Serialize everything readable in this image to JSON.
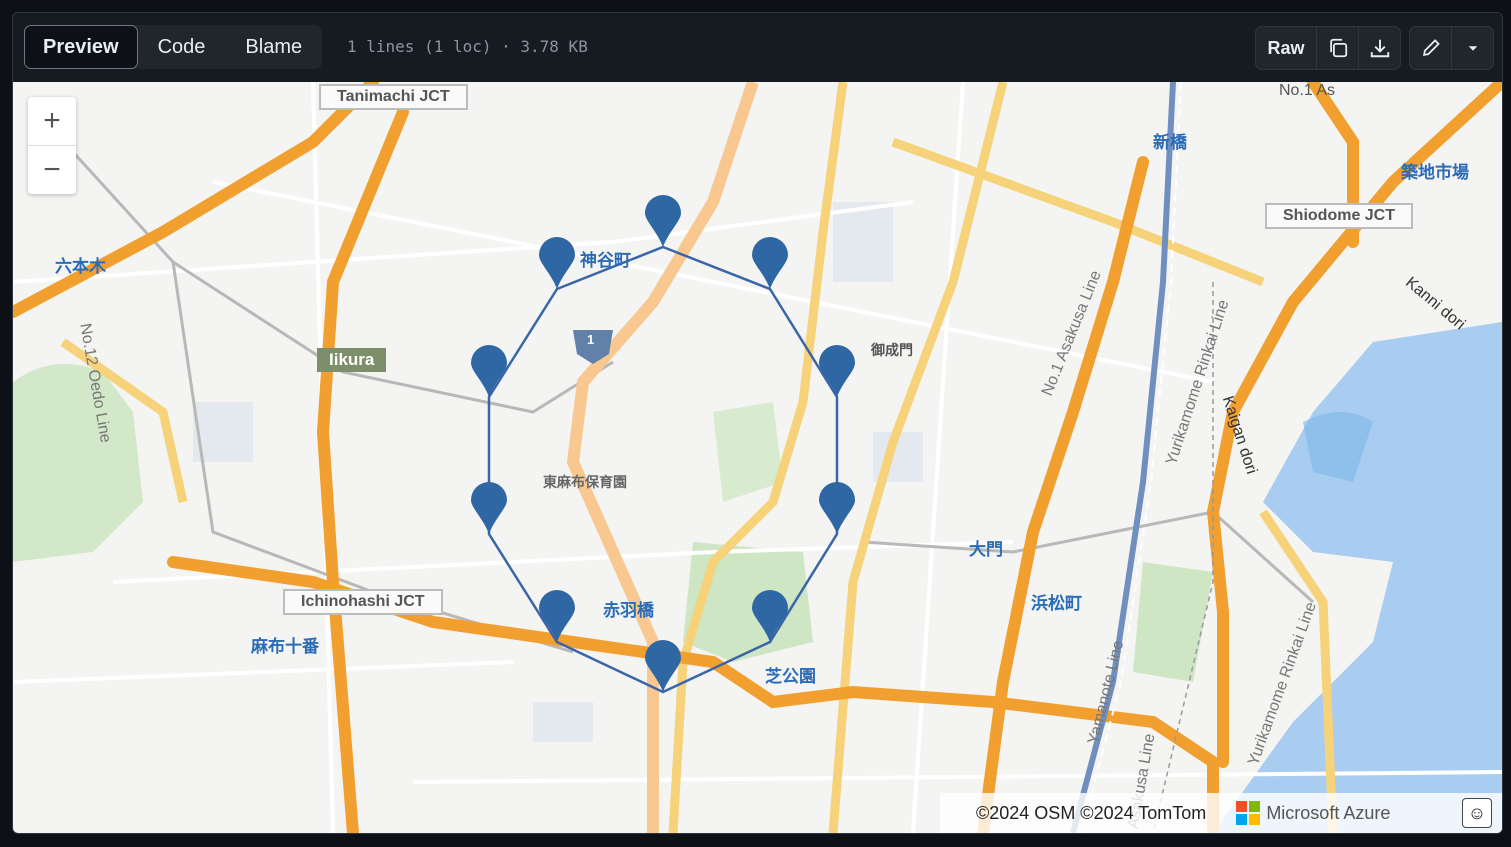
{
  "toolbar": {
    "tabs": [
      "Preview",
      "Code",
      "Blame"
    ],
    "meta": "1 lines (1 loc) · 3.78 KB",
    "raw_label": "Raw",
    "icons": [
      "copy-icon",
      "download-icon",
      "pencil-icon",
      "chevron-down-icon"
    ]
  },
  "map": {
    "zoom_in": "+",
    "zoom_out": "−",
    "labels": {
      "tanimachi": "Tanimachi JCT",
      "roppongi": "六本木",
      "oedo": "No.12 Oedo Line",
      "iikura": "Iikura",
      "kamiyacho": "神谷町",
      "onarimon": "御成門",
      "higashiazabu": "東麻布保育園",
      "ichinohashi": "Ichinohashi JCT",
      "azabujuban": "麻布十番",
      "akabanebashi": "赤羽橋",
      "shibakoen": "芝公園",
      "daimon": "大門",
      "hamamatsucho": "浜松町",
      "shimbashi": "新橋",
      "tsukiji": "築地市場",
      "shiodome": "Shiodome JCT",
      "kanni": "Kanni dori",
      "kaigan": "Kaigan dori",
      "asakusa": "No.1 Asakusa Line",
      "yurikamome": "Yurikamome Rinkai Line",
      "yurikamome2": "Yurikamome Rinkai Line",
      "yamanote": "Yamanote Line",
      "asakusa2": "Asakusa Line",
      "route1": "1",
      "no1": "No.1 As"
    },
    "attribution": "©2024 OSM ©2024 TomTom",
    "brand": "Microsoft Azure",
    "feedback_icon": "smiley-icon",
    "pin_color": "#2f67a4",
    "polygon_color": "#3a65a8"
  }
}
